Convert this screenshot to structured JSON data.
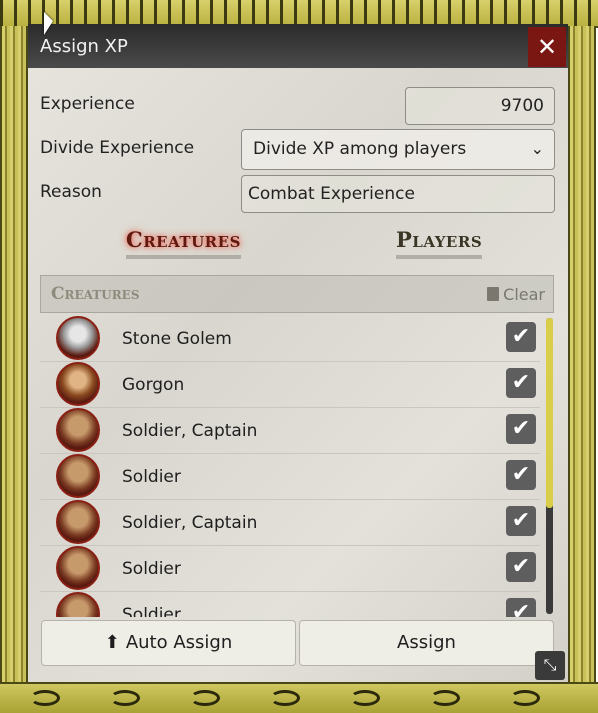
{
  "window": {
    "title": "Assign XP",
    "close_glyph": "✕"
  },
  "form": {
    "experience_label": "Experience",
    "experience_value": "9700",
    "divide_label": "Divide Experience",
    "divide_selected": "Divide XP among players",
    "reason_label": "Reason",
    "reason_value": "Combat Experience"
  },
  "tabs": [
    {
      "label": "Creatures",
      "active": true
    },
    {
      "label": "Players",
      "active": false
    }
  ],
  "list_header": {
    "title": "Creatures",
    "clear_label": "Clear"
  },
  "creatures": [
    {
      "name": "Stone Golem",
      "checked": true,
      "icon": "stone-golem-portrait"
    },
    {
      "name": "Gorgon",
      "checked": true,
      "icon": "gorgon-portrait"
    },
    {
      "name": "Soldier, Captain",
      "checked": true,
      "icon": "soldier-portrait"
    },
    {
      "name": "Soldier",
      "checked": true,
      "icon": "soldier-portrait"
    },
    {
      "name": "Soldier, Captain",
      "checked": true,
      "icon": "soldier-portrait"
    },
    {
      "name": "Soldier",
      "checked": true,
      "icon": "soldier-portrait"
    },
    {
      "name": "Soldier",
      "checked": true,
      "icon": "soldier-portrait"
    }
  ],
  "buttons": {
    "auto_assign": "Auto Assign",
    "assign": "Assign"
  },
  "glyphs": {
    "check": "✔",
    "upload": "⬆",
    "chevron": "⌄",
    "resize": "⤡"
  },
  "colors": {
    "close_bg": "#7b1713",
    "scroll_thumb": "#d9cd4a",
    "frame_gold": "#cfc760"
  }
}
